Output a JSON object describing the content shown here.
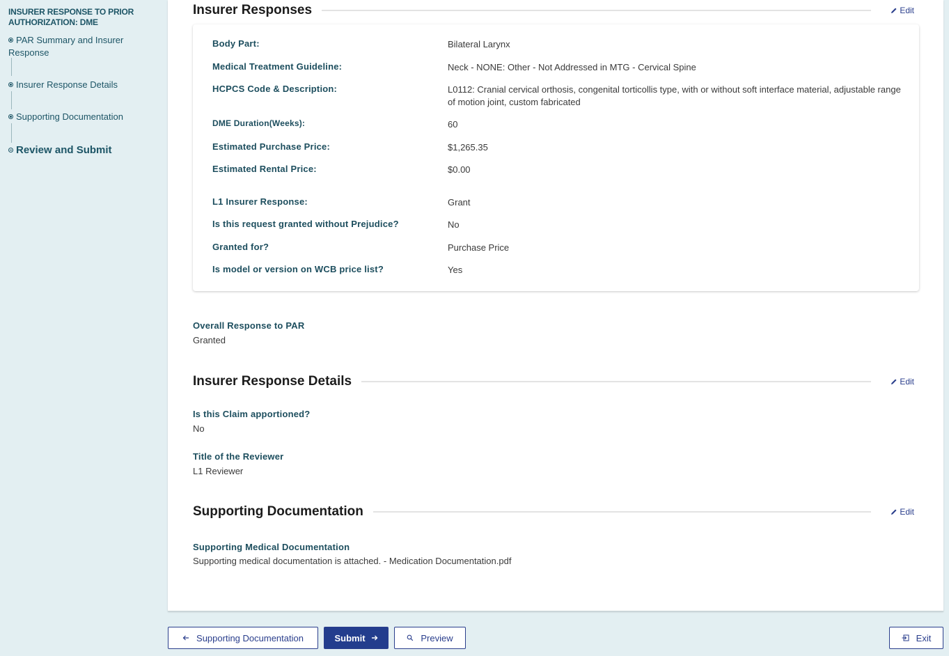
{
  "sidebar": {
    "title": "INSURER RESPONSE TO PRIOR AUTHORIZATION: DME",
    "steps": [
      {
        "label": "PAR Summary and Insurer Response",
        "state": "completed"
      },
      {
        "label": "Insurer Response Details",
        "state": "completed"
      },
      {
        "label": "Supporting Documentation",
        "state": "completed"
      },
      {
        "label": "Review and Submit",
        "state": "current"
      }
    ]
  },
  "sections": {
    "insurer_responses": {
      "title": "Insurer Responses",
      "edit_label": "Edit",
      "fields": [
        {
          "label": "Body Part:",
          "value": "Bilateral Larynx"
        },
        {
          "label": "Medical Treatment Guideline:",
          "value": "Neck - NONE: Other - Not Addressed in MTG - Cervical Spine"
        },
        {
          "label": "HCPCS Code & Description:",
          "value": "L0112: Cranial cervical orthosis, congenital torticollis type, with or without soft interface material, adjustable range of motion joint, custom fabricated"
        },
        {
          "label": "DME Duration(Weeks):",
          "value": "60"
        },
        {
          "label": "Estimated Purchase Price:",
          "value": "$1,265.35"
        },
        {
          "label": "Estimated Rental Price:",
          "value": "$0.00"
        },
        {
          "label": "L1 Insurer Response:",
          "value": "Grant"
        },
        {
          "label": "Is this request granted without Prejudice?",
          "value": "No"
        },
        {
          "label": "Granted for?",
          "value": "Purchase Price"
        },
        {
          "label": "Is model or version on WCB price list?",
          "value": "Yes"
        }
      ],
      "overall": {
        "label": "Overall Response to PAR",
        "value": "Granted"
      }
    },
    "insurer_response_details": {
      "title": "Insurer Response Details",
      "edit_label": "Edit",
      "fields": [
        {
          "label": "Is this Claim apportioned?",
          "value": "No"
        },
        {
          "label": "Title of the Reviewer",
          "value": "L1 Reviewer"
        }
      ]
    },
    "supporting_documentation": {
      "title": "Supporting Documentation",
      "edit_label": "Edit",
      "fields": [
        {
          "label": "Supporting Medical Documentation",
          "value": "Supporting medical documentation is attached.  - Medication Documentation.pdf"
        }
      ]
    }
  },
  "footer": {
    "back_label": "Supporting Documentation",
    "submit_label": "Submit",
    "preview_label": "Preview",
    "exit_label": "Exit"
  },
  "colors": {
    "primary": "#233d8d",
    "label_teal": "#1d4e5e",
    "background": "#e3eff2"
  }
}
